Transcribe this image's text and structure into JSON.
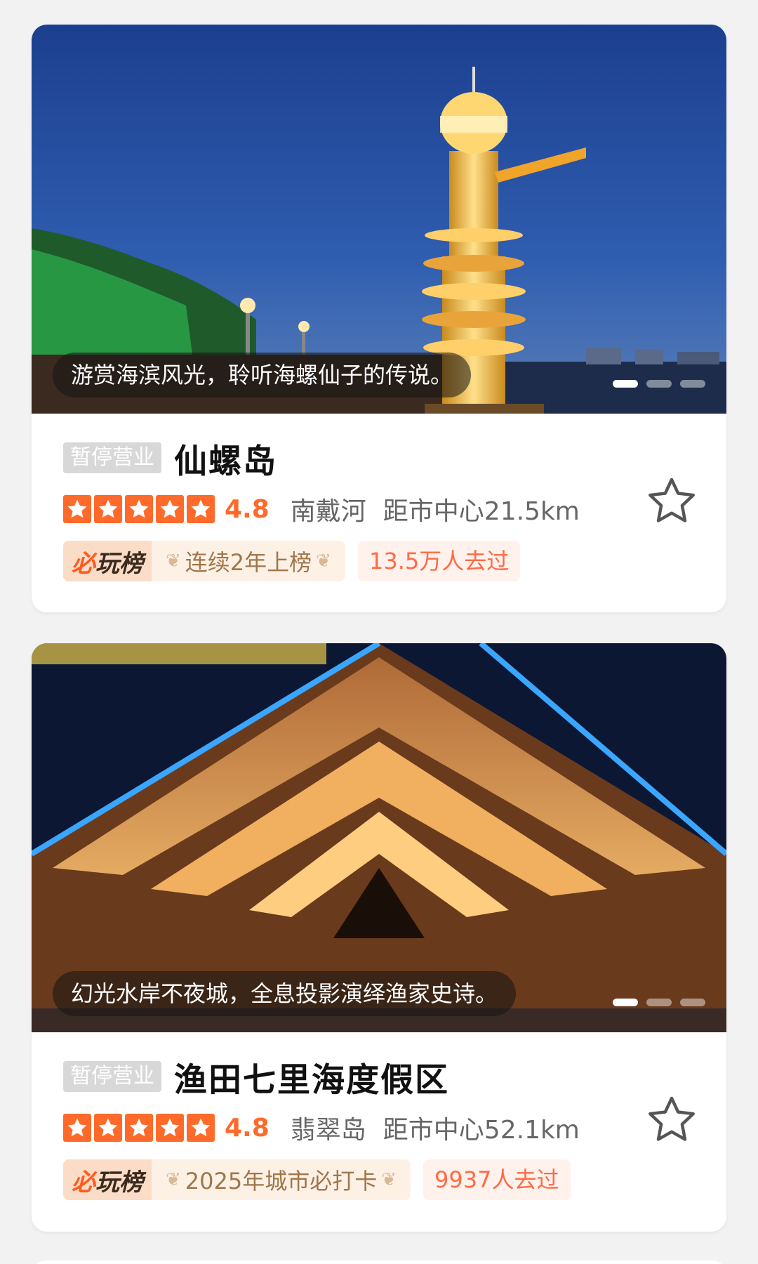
{
  "cards": [
    {
      "caption": "游赏海滨风光，聆听海螺仙子的传说。",
      "status": "暂停营业",
      "name": "仙螺岛",
      "rating": "4.8",
      "area": "南戴河",
      "distance": "距市中心21.5km",
      "rank_logo_a": "必",
      "rank_logo_b": "玩榜",
      "rank_text": "连续2年上榜",
      "visits": "13.5万人去过",
      "favorite_icon": "star-outline-icon"
    },
    {
      "caption": "幻光水岸不夜城，全息投影演绎渔家史诗。",
      "status": "暂停营业",
      "name": "渔田七里海度假区",
      "rating": "4.8",
      "area": "翡翠岛",
      "distance": "距市中心52.1km",
      "rank_logo_a": "必",
      "rank_logo_b": "玩榜",
      "rank_text": "2025年城市必打卡",
      "visits": "9937人去过",
      "favorite_icon": "star-outline-icon"
    }
  ],
  "colors": {
    "accent": "#ff6a2b",
    "closed_tag_bg": "#d8d8d8",
    "visits_text": "#ff6a45"
  }
}
